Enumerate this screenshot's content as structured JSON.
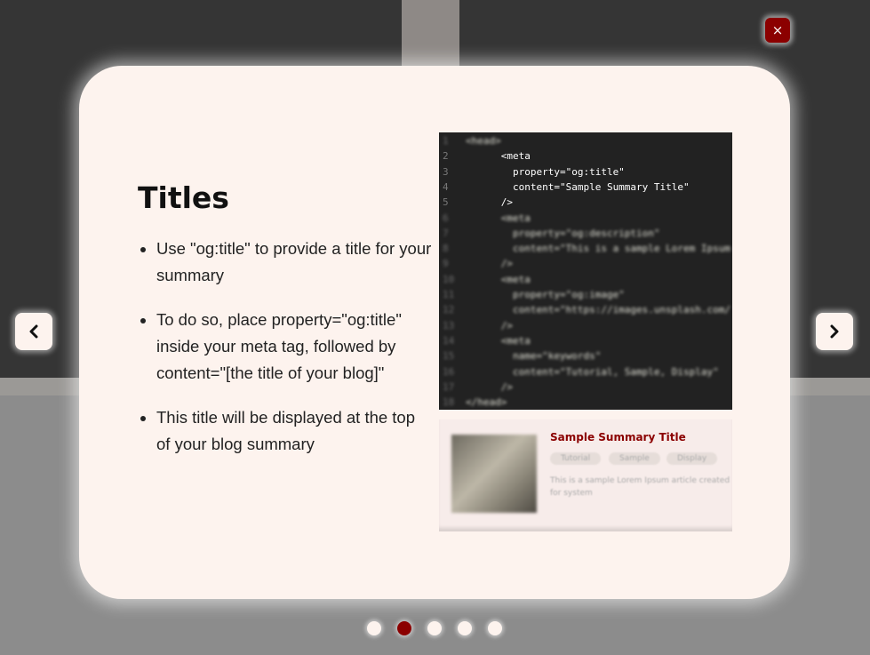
{
  "controls": {
    "close_label": "×",
    "prev_icon": "chevron-left-icon",
    "next_icon": "chevron-right-icon"
  },
  "slide": {
    "title": "Titles",
    "bullets": [
      "Use \"og:title\" to provide a title for your summary",
      "To do so, place property=\"og:title\" inside your meta tag, followed by content=\"[the title of your blog]\"",
      "This title will be displayed at the top of your blog summary"
    ]
  },
  "code": {
    "lines": [
      {
        "n": "1",
        "t": "<head>"
      },
      {
        "n": "2",
        "t": "      <meta"
      },
      {
        "n": "3",
        "t": "        property=\"og:title\""
      },
      {
        "n": "4",
        "t": "        content=\"Sample Summary Title\""
      },
      {
        "n": "5",
        "t": "      />"
      },
      {
        "n": "6",
        "t": "      <meta"
      },
      {
        "n": "7",
        "t": "        property=\"og:description\""
      },
      {
        "n": "8",
        "t": "        content=\"This is a sample Lorem Ipsum"
      },
      {
        "n": "9",
        "t": "      />"
      },
      {
        "n": "10",
        "t": "      <meta"
      },
      {
        "n": "11",
        "t": "        property=\"og:image\""
      },
      {
        "n": "12",
        "t": "        content=\"https://images.unsplash.com/"
      },
      {
        "n": "13",
        "t": "      />"
      },
      {
        "n": "14",
        "t": "      <meta"
      },
      {
        "n": "15",
        "t": "        name=\"keywords\""
      },
      {
        "n": "16",
        "t": "        content=\"Tutorial, Sample, Display\""
      },
      {
        "n": "17",
        "t": "      />"
      },
      {
        "n": "18",
        "t": "</head>"
      }
    ]
  },
  "preview": {
    "title": "Sample Summary Title",
    "tags": [
      "Tutorial",
      "Sample",
      "Display"
    ],
    "text": "This is a sample Lorem Ipsum article created for system"
  },
  "pagination": {
    "count": 5,
    "active_index": 1
  },
  "colors": {
    "accent": "#8b0000",
    "modal_bg": "#fdf3ee",
    "code_bg": "#222222"
  }
}
